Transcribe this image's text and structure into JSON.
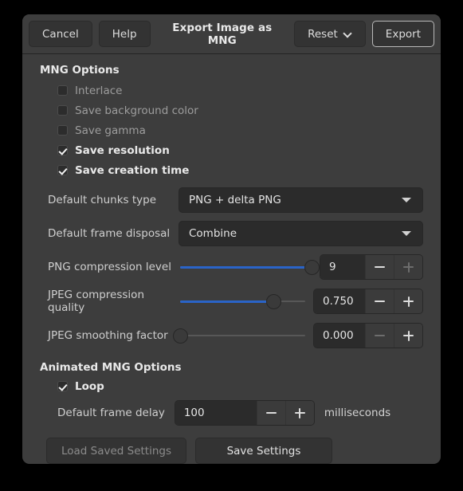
{
  "header": {
    "cancel_label": "Cancel",
    "help_label": "Help",
    "title": "Export Image as MNG",
    "reset_label": "Reset",
    "export_label": "Export"
  },
  "mng_options": {
    "section_title": "MNG Options",
    "checkboxes": [
      {
        "label": "Interlace",
        "checked": false
      },
      {
        "label": "Save background color",
        "checked": false
      },
      {
        "label": "Save gamma",
        "checked": false
      },
      {
        "label": "Save resolution",
        "checked": true
      },
      {
        "label": "Save creation time",
        "checked": true
      }
    ],
    "combos": [
      {
        "label": "Default chunks type",
        "value": "PNG + delta PNG"
      },
      {
        "label": "Default frame disposal",
        "value": "Combine"
      }
    ],
    "sliders": [
      {
        "label": "PNG compression level",
        "value": "9",
        "percent": 100,
        "minus_enabled": true,
        "plus_enabled": false
      },
      {
        "label": "JPEG compression quality",
        "value": "0.750",
        "percent": 75,
        "minus_enabled": true,
        "plus_enabled": true
      },
      {
        "label": "JPEG smoothing factor",
        "value": "0.000",
        "percent": 0,
        "minus_enabled": false,
        "plus_enabled": true
      }
    ]
  },
  "animated": {
    "section_title": "Animated MNG Options",
    "loop": {
      "label": "Loop",
      "checked": true
    },
    "frame_delay": {
      "label": "Default frame delay",
      "value": "100",
      "units": "milliseconds"
    }
  },
  "footer": {
    "load_label": "Load Saved Settings",
    "load_enabled": false,
    "save_label": "Save Settings",
    "save_enabled": true
  },
  "colors": {
    "dialog_bg": "#3d3d3d",
    "field_bg": "#2b2b2b",
    "button_bg": "#333333",
    "accent_blue": "#2a64c8",
    "text": "#e4e4e4",
    "text_dim": "#9d9d9d"
  }
}
